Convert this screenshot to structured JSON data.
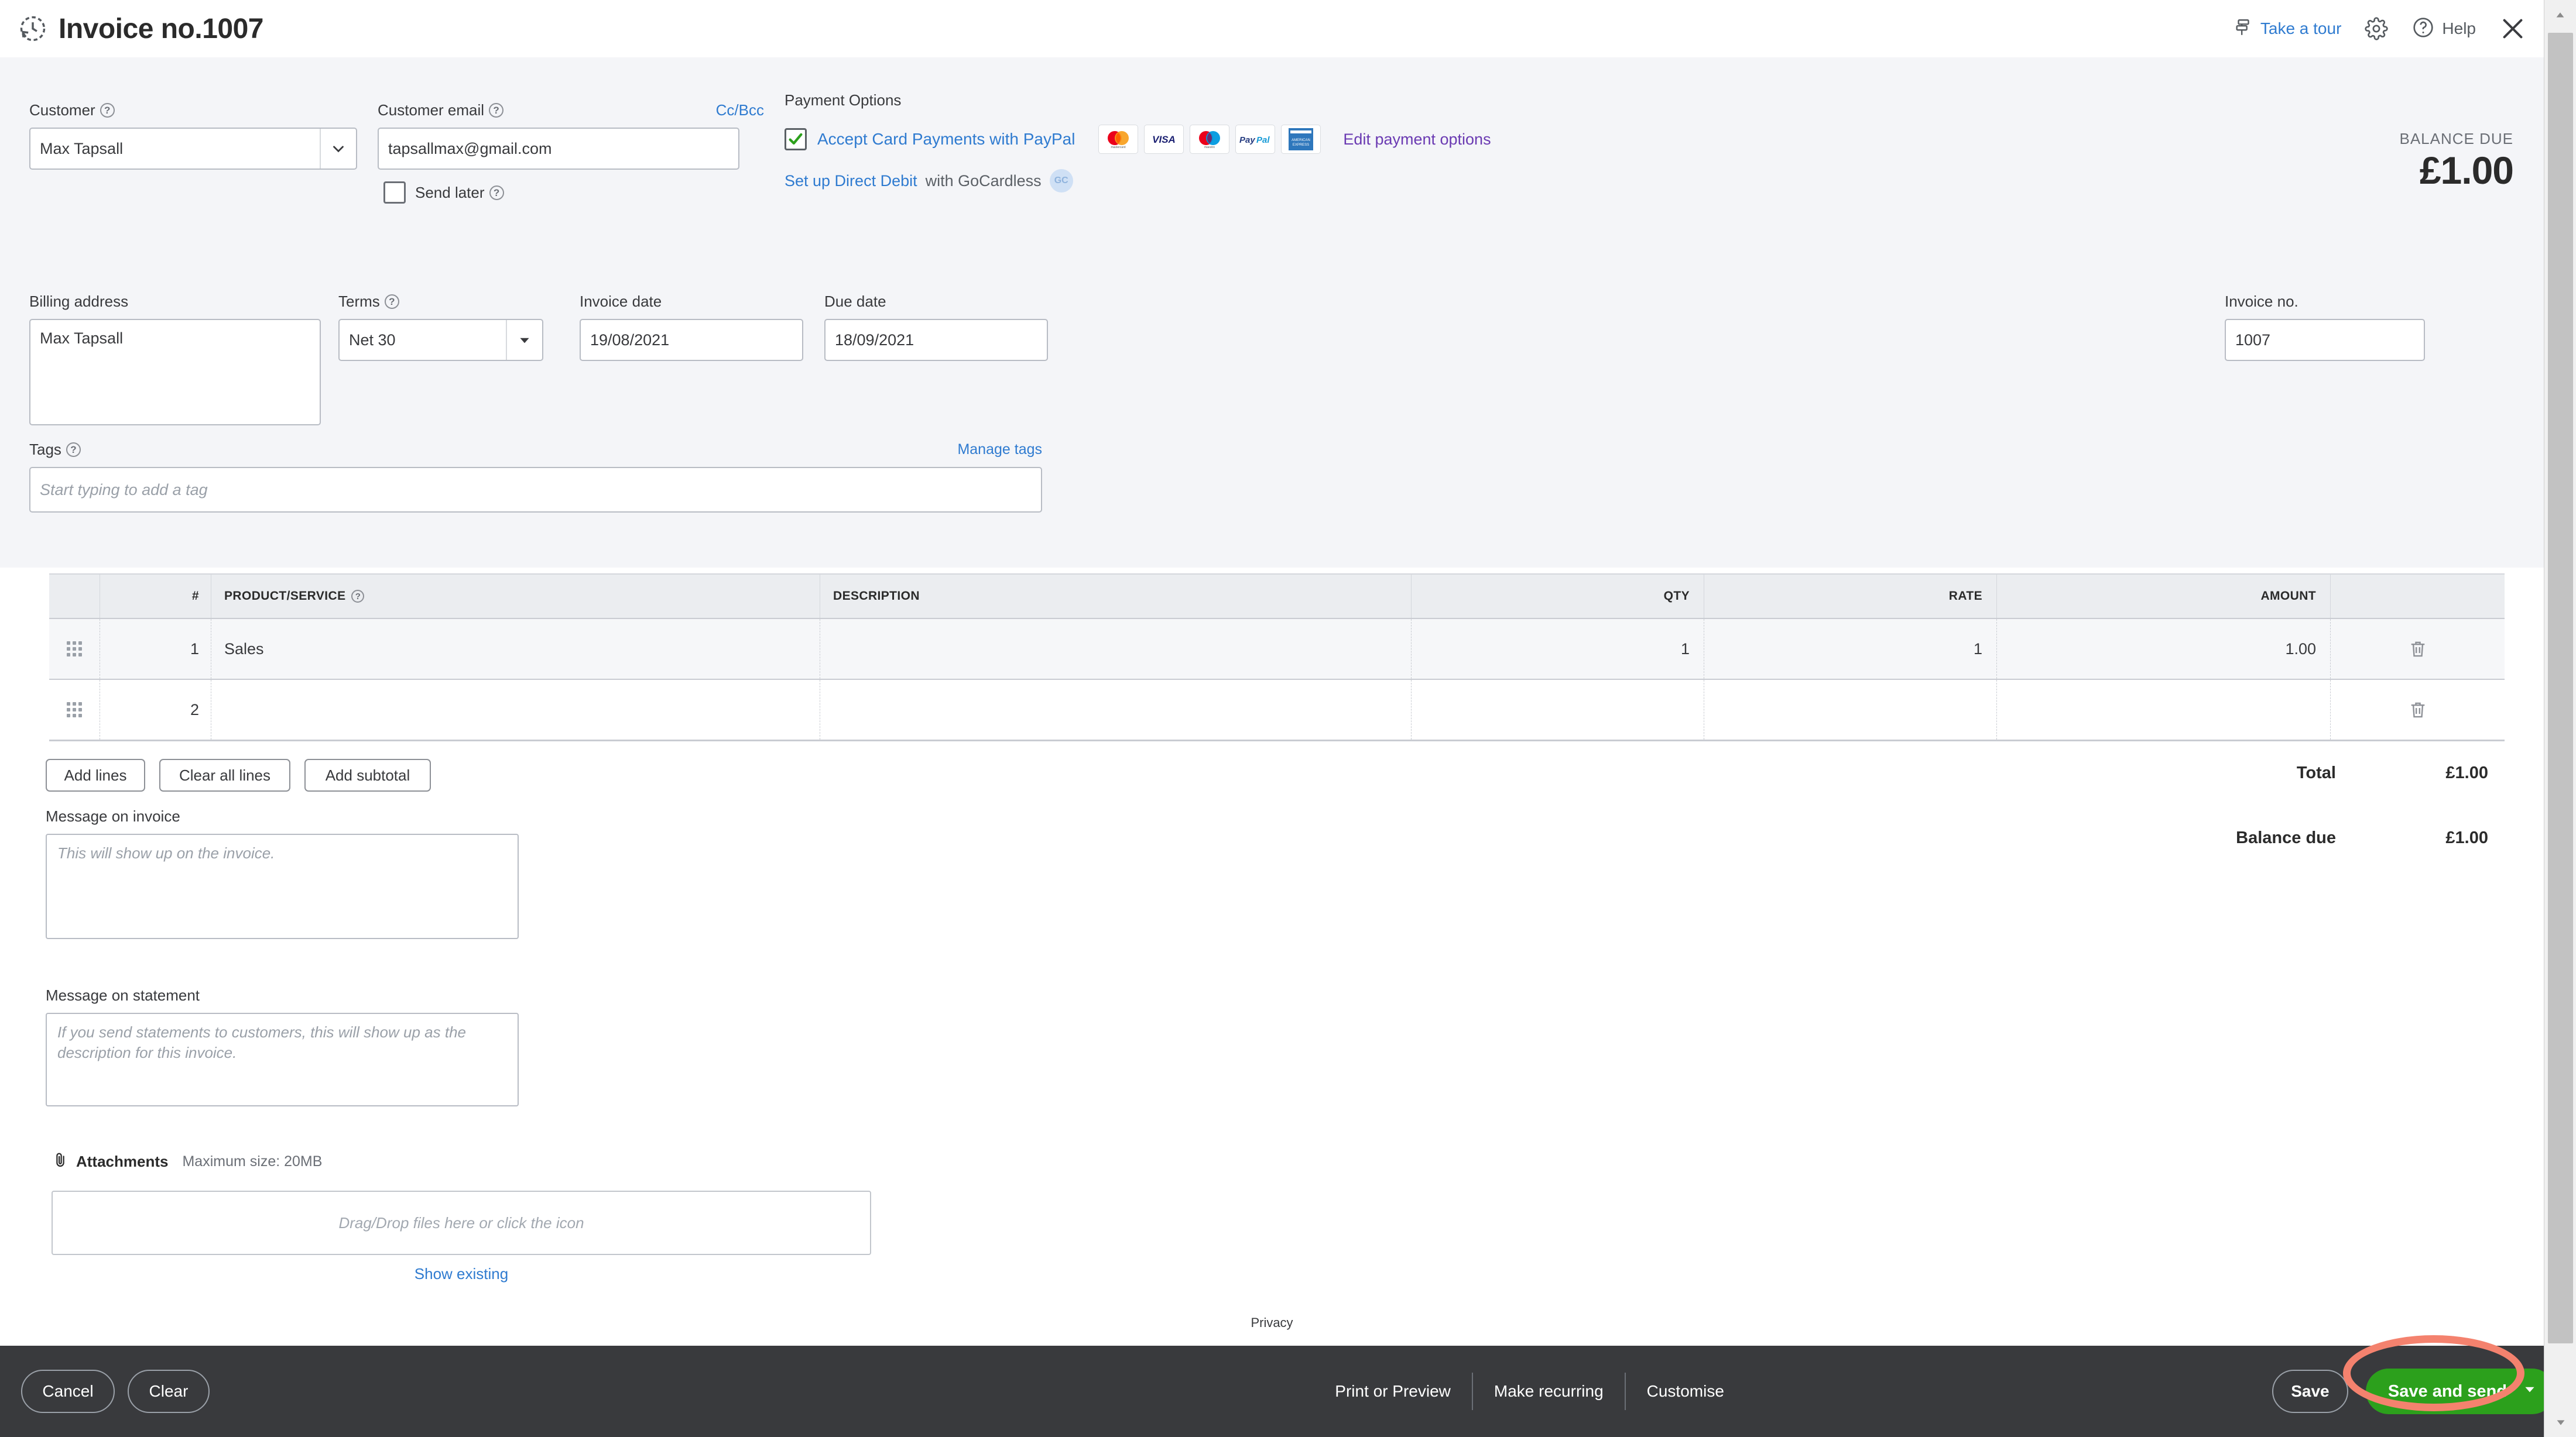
{
  "header": {
    "title": "Invoice no.1007",
    "recurring_icon": "recurring-clock-icon",
    "take_a_tour": "Take a tour",
    "gear_icon": "gear-icon",
    "help": "Help",
    "close_icon": "close-icon"
  },
  "form": {
    "customer": {
      "label": "Customer",
      "value": "Max Tapsall",
      "help_icon": "question-mark-icon",
      "dropdown_icon": "chevron-down-icon"
    },
    "customer_email": {
      "label": "Customer email",
      "value": "tapsallmax@gmail.com",
      "cc_bcc": "Cc/Bcc",
      "help_icon": "question-mark-icon"
    },
    "send_later": {
      "label": "Send later",
      "checked": false,
      "help_icon": "question-mark-icon"
    },
    "payment_options": {
      "title": "Payment Options",
      "accept_card": "Accept Card Payments with PayPal",
      "accept_card_checked": true,
      "cards": [
        "mastercard",
        "visa",
        "maestro",
        "paypal",
        "amex"
      ],
      "edit_link": "Edit payment options",
      "direct_debit_link": "Set up Direct Debit",
      "direct_debit_rest": " with GoCardless",
      "gocardless_badge": "GC"
    },
    "balance_due": {
      "label": "BALANCE DUE",
      "amount": "£1.00"
    },
    "billing_address": {
      "label": "Billing address",
      "value": "Max Tapsall"
    },
    "terms": {
      "label": "Terms",
      "value": "Net 30",
      "help_icon": "question-mark-icon",
      "dropdown_icon": "caret-down-icon"
    },
    "invoice_date": {
      "label": "Invoice date",
      "value": "19/08/2021"
    },
    "due_date": {
      "label": "Due date",
      "value": "18/09/2021"
    },
    "invoice_no": {
      "label": "Invoice no.",
      "value": "1007"
    },
    "tags": {
      "label": "Tags",
      "placeholder": "Start typing to add a tag",
      "manage_link": "Manage tags",
      "help_icon": "question-mark-icon"
    }
  },
  "line_items": {
    "columns": [
      "",
      "#",
      "PRODUCT/SERVICE",
      "DESCRIPTION",
      "QTY",
      "RATE",
      "AMOUNT",
      ""
    ],
    "product_help_icon": "question-mark-icon",
    "rows": [
      {
        "num": "1",
        "product": "Sales",
        "description": "",
        "qty": "1",
        "rate": "1",
        "amount": "1.00",
        "grip_icon": "drag-handle-icon",
        "delete_icon": "trash-icon"
      },
      {
        "num": "2",
        "product": "",
        "description": "",
        "qty": "",
        "rate": "",
        "amount": "",
        "grip_icon": "drag-handle-icon",
        "delete_icon": "trash-icon"
      }
    ],
    "buttons": {
      "add_lines": "Add lines",
      "clear_all_lines": "Clear all lines",
      "add_subtotal": "Add subtotal"
    }
  },
  "totals": {
    "total_label": "Total",
    "total_value": "£1.00",
    "balance_label": "Balance due",
    "balance_value": "£1.00"
  },
  "messages": {
    "invoice_label": "Message on invoice",
    "invoice_placeholder": "This will show up on the invoice.",
    "statement_label": "Message on statement",
    "statement_placeholder": "If you send statements to customers, this will show up as the description for this invoice."
  },
  "attachments": {
    "label": "Attachments",
    "icon": "paperclip-icon",
    "max_size": "Maximum size: 20MB",
    "dropzone_placeholder": "Drag/Drop files here or click the icon",
    "show_existing": "Show existing"
  },
  "footer": {
    "privacy": "Privacy",
    "cancel": "Cancel",
    "clear": "Clear",
    "print_or_preview": "Print or Preview",
    "make_recurring": "Make recurring",
    "customise": "Customise",
    "save": "Save",
    "save_and_send": "Save and send",
    "save_send_caret_icon": "caret-down-icon"
  },
  "colors": {
    "accent_blue": "#2f7bd0",
    "save_green": "#2ca01c",
    "footer_dark": "#393a3d",
    "panel_bg": "#f4f5f8",
    "highlight_red": "#f4826e"
  },
  "scrollbar": {
    "up_icon": "caret-up-icon",
    "down_icon": "caret-down-icon"
  }
}
